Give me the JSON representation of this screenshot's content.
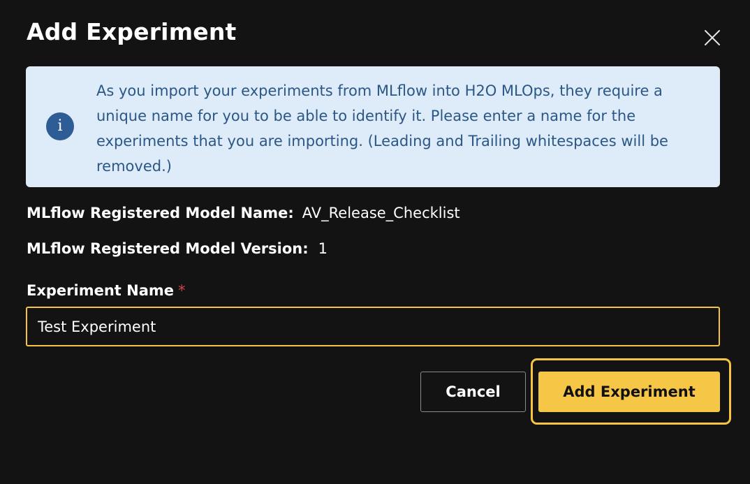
{
  "dialog": {
    "title": "Add Experiment",
    "close_icon": "close-icon"
  },
  "info": {
    "icon": "info-icon",
    "icon_glyph": "i",
    "message": "As you import your experiments from MLflow into H2O MLOps, they require a unique name for you to be able to identify it. Please enter a name for the experiments that you are importing. (Leading and Trailing whitespaces will be removed.)"
  },
  "model": {
    "name_label": "MLflow Registered Model Name:",
    "name_value": "AV_Release_Checklist",
    "version_label": "MLflow Registered Model Version:",
    "version_value": "1"
  },
  "form": {
    "experiment_name_label": "Experiment Name",
    "required_marker": "*",
    "experiment_name_value": "Test Experiment"
  },
  "actions": {
    "cancel_label": "Cancel",
    "add_label": "Add Experiment"
  },
  "colors": {
    "background": "#131313",
    "accent": "#f6c646",
    "info_background": "#deebf8",
    "info_text": "#2b5787",
    "info_icon": "#2e5c95",
    "required": "#d64545"
  }
}
